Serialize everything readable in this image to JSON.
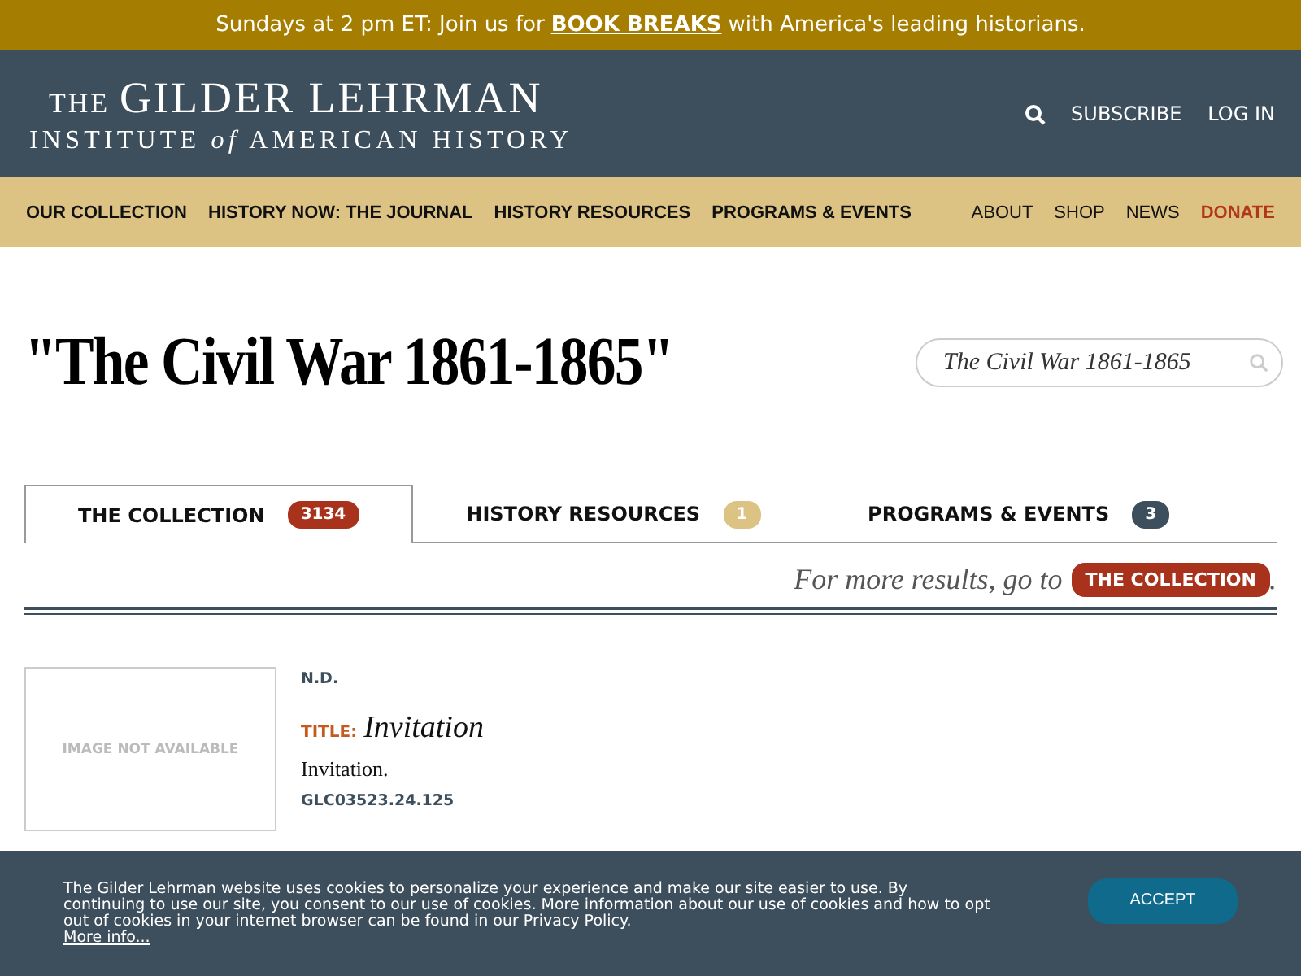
{
  "announcement": {
    "before": "Sundays at 2 pm ET: Join us for",
    "link": "BOOK BREAKS",
    "after": "with America's leading historians."
  },
  "header": {
    "logo": {
      "prefix": "THE",
      "main": "GILDER LEHRMAN",
      "line2": "INSTITUTE *of* AMERICAN HISTORY"
    },
    "links": [
      "SUBSCRIBE",
      "LOG IN"
    ]
  },
  "nav": {
    "primary": [
      "OUR COLLECTION",
      "HISTORY NOW: THE JOURNAL",
      "HISTORY RESOURCES",
      "PROGRAMS & EVENTS"
    ],
    "secondary": [
      {
        "label": "ABOUT",
        "kind": "plain"
      },
      {
        "label": "SHOP",
        "kind": "plain"
      },
      {
        "label": "NEWS",
        "kind": "plain"
      },
      {
        "label": "DONATE",
        "kind": "accent"
      }
    ]
  },
  "page_title": "\"The Civil War 1861-1865\"",
  "search": {
    "value": "The Civil War 1861-1865"
  },
  "tabs": [
    {
      "label": "THE COLLECTION",
      "count": "3134",
      "color": "#a8321b",
      "selected": true
    },
    {
      "label": "HISTORY RESOURCES",
      "count": "1",
      "color": "#dcc384",
      "selected": false
    },
    {
      "label": "PROGRAMS & EVENTS",
      "count": "3",
      "color": "#3d4f5c",
      "selected": false
    }
  ],
  "more_results": {
    "text": "For more results, go to",
    "button": "THE COLLECTION",
    "end": "."
  },
  "results": [
    {
      "image_text": "IMAGE NOT AVAILABLE",
      "date": "N.D.",
      "title_label": "TITLE:",
      "title": "Invitation",
      "description": "Invitation.",
      "id": "GLC03523.24.125"
    }
  ],
  "cookie_banner": {
    "text": "The Gilder Lehrman website uses cookies to personalize your experience and make our site easier to use. By continuing to use our site, you consent to our use of cookies. More information about our use of cookies and how to opt out of cookies in your internet browser can be found in our Privacy Policy.",
    "link": "More info...",
    "button": "ACCEPT"
  }
}
